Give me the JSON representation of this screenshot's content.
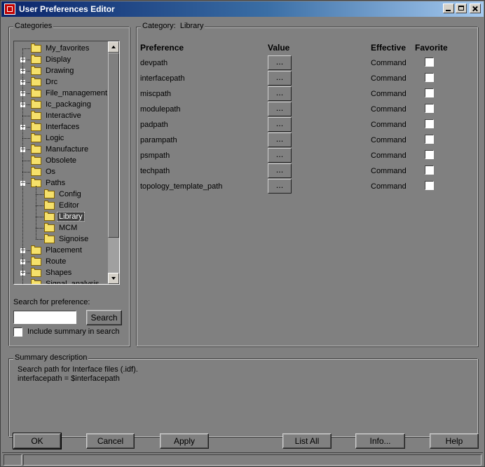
{
  "window": {
    "title": "User Preferences Editor"
  },
  "categories": {
    "group_label": "Categories",
    "tree": [
      {
        "label": "My_favorites",
        "expandable": false
      },
      {
        "label": "Display",
        "expandable": true
      },
      {
        "label": "Drawing",
        "expandable": true
      },
      {
        "label": "Drc",
        "expandable": true
      },
      {
        "label": "File_management",
        "expandable": true
      },
      {
        "label": "Ic_packaging",
        "expandable": true
      },
      {
        "label": "Interactive",
        "expandable": false
      },
      {
        "label": "Interfaces",
        "expandable": true
      },
      {
        "label": "Logic",
        "expandable": false
      },
      {
        "label": "Manufacture",
        "expandable": true
      },
      {
        "label": "Obsolete",
        "expandable": false
      },
      {
        "label": "Os",
        "expandable": false
      },
      {
        "label": "Paths",
        "expandable": true,
        "expanded": true,
        "children": [
          {
            "label": "Config"
          },
          {
            "label": "Editor"
          },
          {
            "label": "Library",
            "selected": true
          },
          {
            "label": "MCM"
          },
          {
            "label": "Signoise"
          }
        ]
      },
      {
        "label": "Placement",
        "expandable": true
      },
      {
        "label": "Route",
        "expandable": true
      },
      {
        "label": "Shapes",
        "expandable": true
      },
      {
        "label": "Signal_analysis",
        "expandable": false
      }
    ],
    "search_label": "Search for preference:",
    "search_value": "",
    "search_button": "Search",
    "include_summary_label": "Include summary in search"
  },
  "category_panel": {
    "group_label": "Category:",
    "category_name": "Library",
    "headers": {
      "preference": "Preference",
      "value": "Value",
      "effective": "Effective",
      "favorite": "Favorite"
    },
    "rows": [
      {
        "name": "devpath",
        "value_button": "...",
        "effective": "Command"
      },
      {
        "name": "interfacepath",
        "value_button": "...",
        "effective": "Command"
      },
      {
        "name": "miscpath",
        "value_button": "...",
        "effective": "Command"
      },
      {
        "name": "modulepath",
        "value_button": "...",
        "effective": "Command"
      },
      {
        "name": "padpath",
        "value_button": "...",
        "effective": "Command"
      },
      {
        "name": "parampath",
        "value_button": "...",
        "effective": "Command"
      },
      {
        "name": "psmpath",
        "value_button": "...",
        "effective": "Command"
      },
      {
        "name": "techpath",
        "value_button": "...",
        "effective": "Command"
      },
      {
        "name": "topology_template_path",
        "value_button": "...",
        "effective": "Command"
      }
    ]
  },
  "summary": {
    "group_label": "Summary description",
    "line1": "Search path for Interface files (.idf).",
    "line2": "interfacepath = $interfacepath"
  },
  "buttons": {
    "ok": "OK",
    "cancel": "Cancel",
    "apply": "Apply",
    "list_all": "List All",
    "info": "Info...",
    "help": "Help"
  }
}
